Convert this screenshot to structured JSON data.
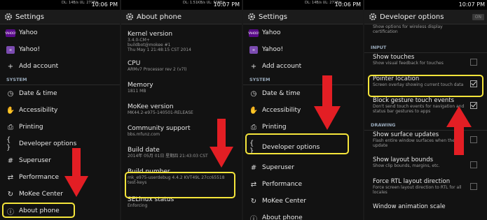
{
  "status": {
    "net_left": "DL 14B/s\nUL 271B/s",
    "times": [
      "10:06 PM",
      "10:07 PM",
      "10:06 PM",
      "10:07 PM"
    ],
    "nets": [
      "DL: 14B/s UL: 271B/s",
      "DL: 1.51KB/s UL: 508B/s",
      "DL: 14B/s UL: 271B/s",
      ""
    ]
  },
  "settings": {
    "title": "Settings",
    "accounts": [
      "Yahoo",
      "Yahoo!",
      "Add account"
    ],
    "system_header": "SYSTEM",
    "items_p1": [
      "Date & time",
      "Accessibility",
      "Printing",
      "Developer options",
      "Superuser",
      "Performance",
      "MoKee Center",
      "About phone"
    ],
    "yahoo_badge": "YAHOO!"
  },
  "about": {
    "title": "About phone",
    "rows": [
      {
        "title": "Kernel version",
        "sub": "3.4.0-CM+\nbuildbot@mokee #1\nThu May 1 21:48:15 CST 2014"
      },
      {
        "title": "CPU",
        "sub": "ARMv7 Processor rev 2 (v7l)"
      },
      {
        "title": "Memory",
        "sub": "1811 MB"
      },
      {
        "title": "MoKee version",
        "sub": "MK44.2-e975-140501-RELEASE"
      },
      {
        "title": "Community support",
        "sub": "bbs.mfunz.com"
      },
      {
        "title": "Build date",
        "sub": "2014年 05月 01日 星期四 21:43:03 CST"
      },
      {
        "title": "Build number",
        "sub": "mk_e975-userdebug 4.4.2 KVT49L 27cc65518\ntest-keys"
      },
      {
        "title": "SELinux status",
        "sub": "Enforcing"
      }
    ]
  },
  "developer": {
    "title": "Developer options",
    "toggle": "ON",
    "top_sub": "Show options for wireless display\ncertification",
    "input_header": "INPUT",
    "drawing_header": "DRAWING",
    "rows": [
      {
        "title": "Show touches",
        "sub": "Show visual feedback for touches",
        "checked": false
      },
      {
        "title": "Pointer location",
        "sub": "Screen overlay showing current touch data",
        "checked": true
      },
      {
        "title": "Block gesture touch events",
        "sub": "Don't send touch events for navigation and\nstatus bar gestures to apps",
        "checked": true
      }
    ],
    "drawing_rows": [
      {
        "title": "Show surface updates",
        "sub": "Flash entire window surfaces when they\nupdate",
        "checked": false
      },
      {
        "title": "Show layout bounds",
        "sub": "Show clip bounds, margins, etc.",
        "checked": false
      },
      {
        "title": "Force RTL layout direction",
        "sub": "Force screen layout direction to RTL for all\nlocales",
        "checked": false
      },
      {
        "title": "Window animation scale",
        "sub": "",
        "checked": false
      }
    ]
  },
  "colors": {
    "highlight": "#f5e53b",
    "arrow": "#e31e24"
  }
}
